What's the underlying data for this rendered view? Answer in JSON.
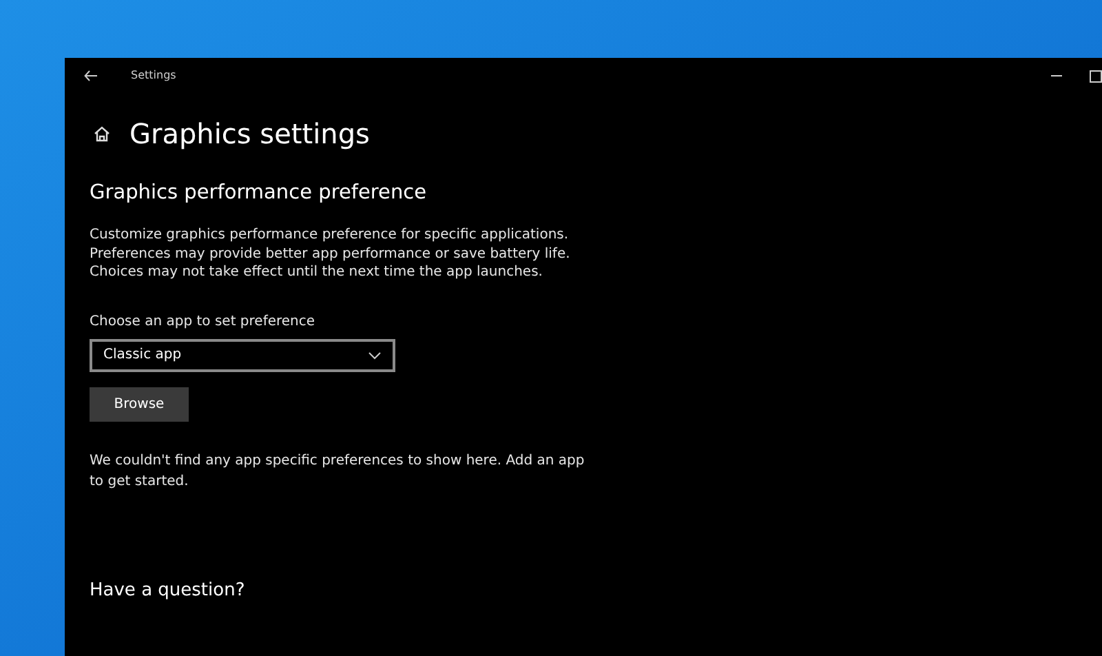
{
  "window": {
    "title": "Settings"
  },
  "page": {
    "title": "Graphics settings"
  },
  "section": {
    "title": "Graphics performance preference",
    "description": "Customize graphics performance preference for specific applications. Preferences may provide better app performance or save battery life. Choices may not take effect until the next time the app launches."
  },
  "app_picker": {
    "label": "Choose an app to set preference",
    "value": "Classic app",
    "button": "Browse"
  },
  "empty_message": "We couldn't find any app specific preferences to show here. Add an app to get started.",
  "help": {
    "title": "Have a question?"
  }
}
